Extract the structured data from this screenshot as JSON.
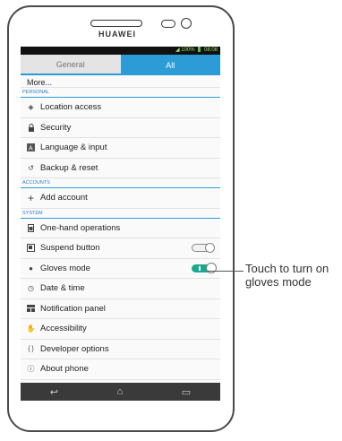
{
  "device": {
    "brand": "HUAWEI"
  },
  "status_bar": {
    "battery": "100%",
    "time": "08:08"
  },
  "tabs": [
    {
      "label": "General"
    },
    {
      "label": "All"
    }
  ],
  "partial_item": "More...",
  "sections": {
    "personal": "PERSONAL",
    "accounts": "ACCOUNTS",
    "system": "SYSTEM"
  },
  "personal_items": [
    {
      "label": "Location access",
      "icon": "location-icon"
    },
    {
      "label": "Security",
      "icon": "lock-icon"
    },
    {
      "label": "Language & input",
      "icon": "keyboard-icon"
    },
    {
      "label": "Backup & reset",
      "icon": "backup-icon"
    }
  ],
  "account_items": [
    {
      "label": "Add account",
      "icon": "plus-icon"
    }
  ],
  "system_items": [
    {
      "label": "One-hand operations",
      "icon": "phone-icon"
    },
    {
      "label": "Suspend button",
      "icon": "suspend-icon",
      "toggle": "off"
    },
    {
      "label": "Gloves mode",
      "icon": "glove-icon",
      "toggle": "on"
    },
    {
      "label": "Date & time",
      "icon": "clock-icon"
    },
    {
      "label": "Notification panel",
      "icon": "panel-icon"
    },
    {
      "label": "Accessibility",
      "icon": "hand-icon"
    },
    {
      "label": "Developer options",
      "icon": "braces-icon"
    },
    {
      "label": "About phone",
      "icon": "info-icon"
    }
  ],
  "callout": "Touch to turn on gloves mode",
  "colors": {
    "accent": "#2d9cd6",
    "toggle_on": "#1aa98d"
  }
}
